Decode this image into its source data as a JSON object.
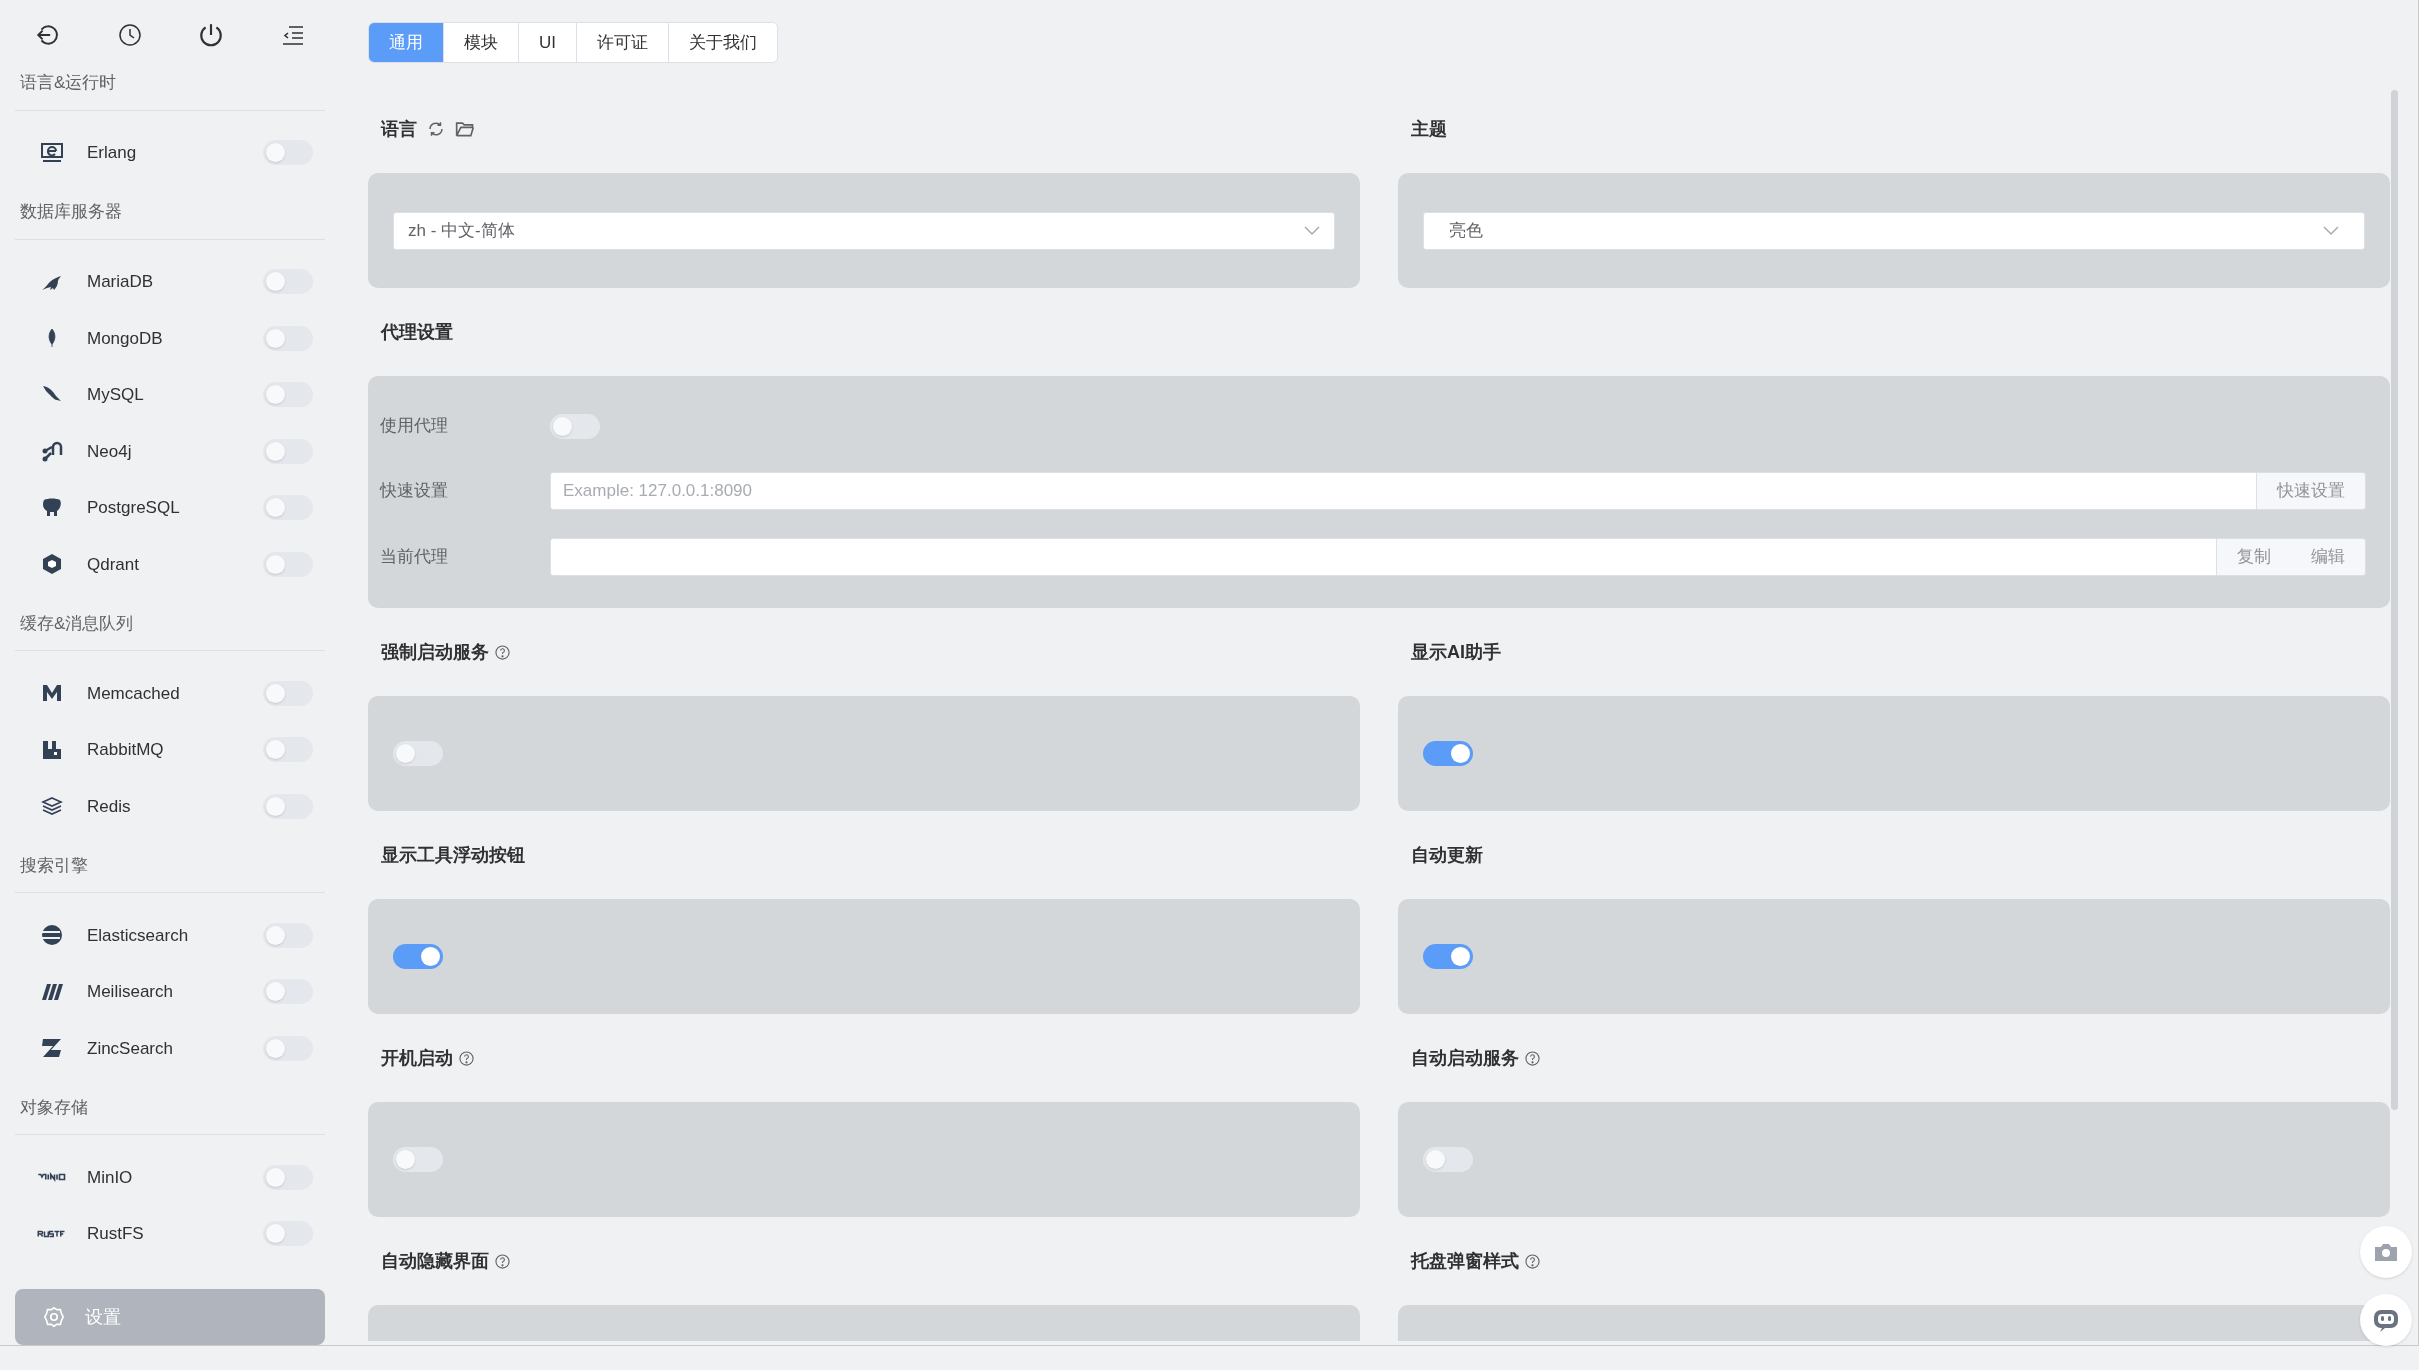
{
  "sidebar": {
    "groups": [
      {
        "title": "语言&运行时",
        "items": [
          {
            "name": "Erlang",
            "on": false
          }
        ]
      },
      {
        "title": "数据库服务器",
        "items": [
          {
            "name": "MariaDB",
            "on": false
          },
          {
            "name": "MongoDB",
            "on": false
          },
          {
            "name": "MySQL",
            "on": false
          },
          {
            "name": "Neo4j",
            "on": false
          },
          {
            "name": "PostgreSQL",
            "on": false
          },
          {
            "name": "Qdrant",
            "on": false
          }
        ]
      },
      {
        "title": "缓存&消息队列",
        "items": [
          {
            "name": "Memcached",
            "on": false
          },
          {
            "name": "RabbitMQ",
            "on": false
          },
          {
            "name": "Redis",
            "on": false
          }
        ]
      },
      {
        "title": "搜索引擎",
        "items": [
          {
            "name": "Elasticsearch",
            "on": false
          },
          {
            "name": "Meilisearch",
            "on": false
          },
          {
            "name": "ZincSearch",
            "on": false
          }
        ]
      },
      {
        "title": "对象存储",
        "items": [
          {
            "name": "MinIO",
            "on": false
          },
          {
            "name": "RustFS",
            "on": false
          }
        ]
      }
    ],
    "settings": {
      "label": "设置",
      "selected": true
    }
  },
  "tabs": [
    {
      "label": "通用",
      "selected": true
    },
    {
      "label": "模块",
      "selected": false
    },
    {
      "label": "UI",
      "selected": false
    },
    {
      "label": "许可证",
      "selected": false
    },
    {
      "label": "关于我们",
      "selected": false
    }
  ],
  "language": {
    "label": "语言",
    "value": "zh - 中文-简体"
  },
  "theme": {
    "label": "主题",
    "value": "亮色"
  },
  "proxy": {
    "title": "代理设置",
    "use_label": "使用代理",
    "use_on": false,
    "quick_label": "快速设置",
    "quick_placeholder": "Example: 127.0.0.1:8090",
    "quick_button": "快速设置",
    "current_label": "当前代理",
    "copy_button": "复制",
    "edit_button": "编辑"
  },
  "options": [
    {
      "label": "强制启动服务",
      "help": true,
      "on": false
    },
    {
      "label": "显示AI助手",
      "help": false,
      "on": true
    },
    {
      "label": "显示工具浮动按钮",
      "help": false,
      "on": true
    },
    {
      "label": "自动更新",
      "help": false,
      "on": true
    },
    {
      "label": "开机启动",
      "help": true,
      "on": false
    },
    {
      "label": "自动启动服务",
      "help": true,
      "on": false
    },
    {
      "label": "自动隐藏界面",
      "help": true
    },
    {
      "label": "托盘弹窗样式",
      "help": true
    }
  ]
}
